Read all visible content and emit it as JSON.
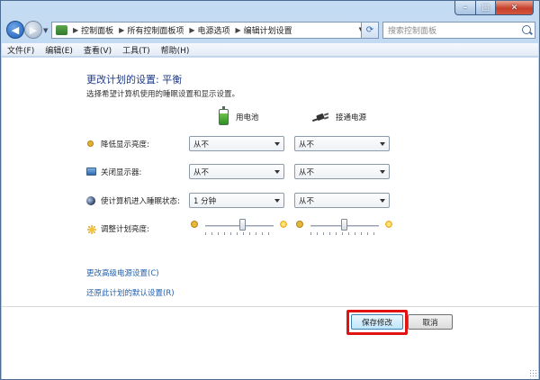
{
  "window": {
    "caption": {
      "minimize": "–",
      "maximize": "□",
      "close": "✕"
    }
  },
  "navigation": {
    "back": "◀",
    "forward": "▶",
    "breadcrumb": [
      "控制面板",
      "所有控制面板项",
      "电源选项",
      "编辑计划设置"
    ],
    "search_placeholder": "搜索控制面板",
    "refresh": "⟳"
  },
  "menu": [
    "文件(F)",
    "编辑(E)",
    "查看(V)",
    "工具(T)",
    "帮助(H)"
  ],
  "main": {
    "title": "更改计划的设置: 平衡",
    "subtitle": "选择希望计算机使用的睡眠设置和显示设置。",
    "columns": {
      "battery": "用电池",
      "plugged_in": "接通电源"
    },
    "rows": [
      {
        "label": "降低显示亮度:",
        "icon": "dim-display-icon",
        "battery": "从不",
        "plugged": "从不"
      },
      {
        "label": "关闭显示器:",
        "icon": "monitor-icon",
        "battery": "从不",
        "plugged": "从不"
      },
      {
        "label": "使计算机进入睡眠状态:",
        "icon": "sleep-moon-icon",
        "battery": "1 分钟",
        "plugged": "从不"
      }
    ],
    "brightness": {
      "label": "调整计划亮度:",
      "battery_level": 0.55,
      "plugged_level": 0.5
    },
    "links": [
      "更改高级电源设置(C)",
      "还原此计划的默认设置(R)"
    ],
    "buttons": {
      "save": "保存修改",
      "cancel": "取消"
    }
  },
  "colors": {
    "highlight": "#e01212",
    "link": "#1f5fae",
    "title": "#1f3b8a"
  }
}
